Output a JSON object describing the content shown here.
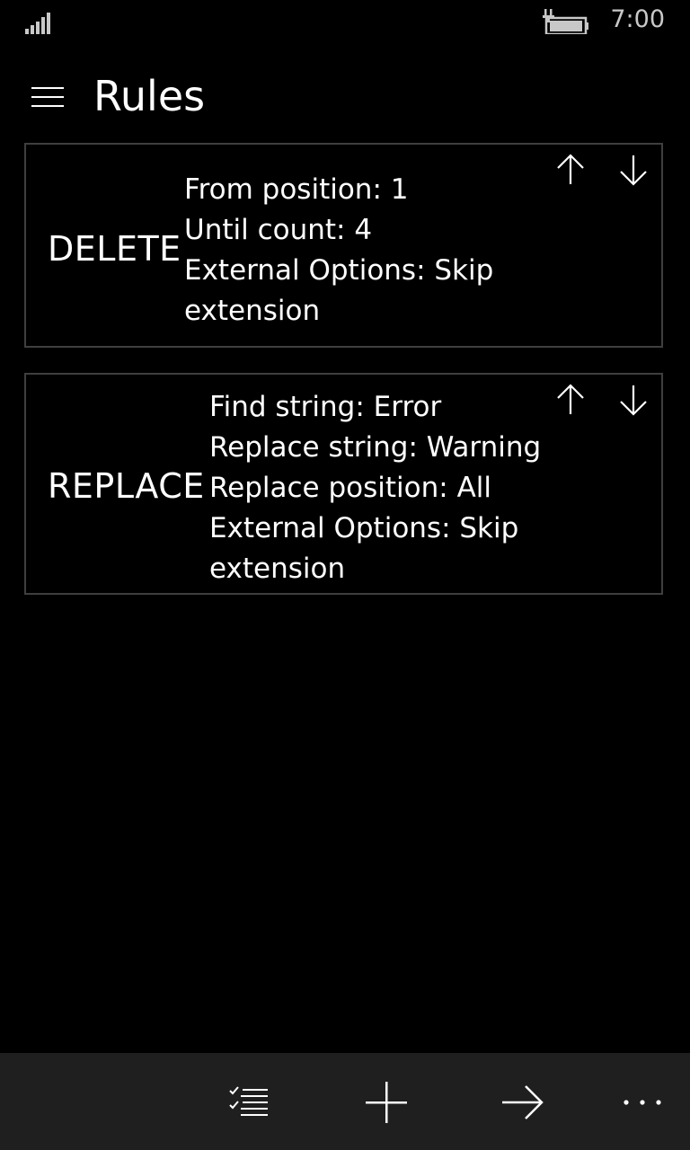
{
  "status_bar": {
    "time": "7:00",
    "icons": [
      "signal-icon",
      "battery-charging-icon"
    ]
  },
  "header": {
    "menu_icon": "hamburger-icon",
    "title": "Rules"
  },
  "rules": [
    {
      "type": "DELETE",
      "details": [
        "From position: 1",
        "Until count: 4",
        "External Options: Skip",
        "extension"
      ]
    },
    {
      "type": "REPLACE",
      "details": [
        "Find string: Error",
        "Replace string: Warning",
        "Replace position: All",
        "External Options: Skip",
        "extension"
      ]
    }
  ],
  "app_bar": {
    "buttons": [
      "select-list-icon",
      "add-icon",
      "forward-arrow-icon",
      "more-icon"
    ]
  }
}
